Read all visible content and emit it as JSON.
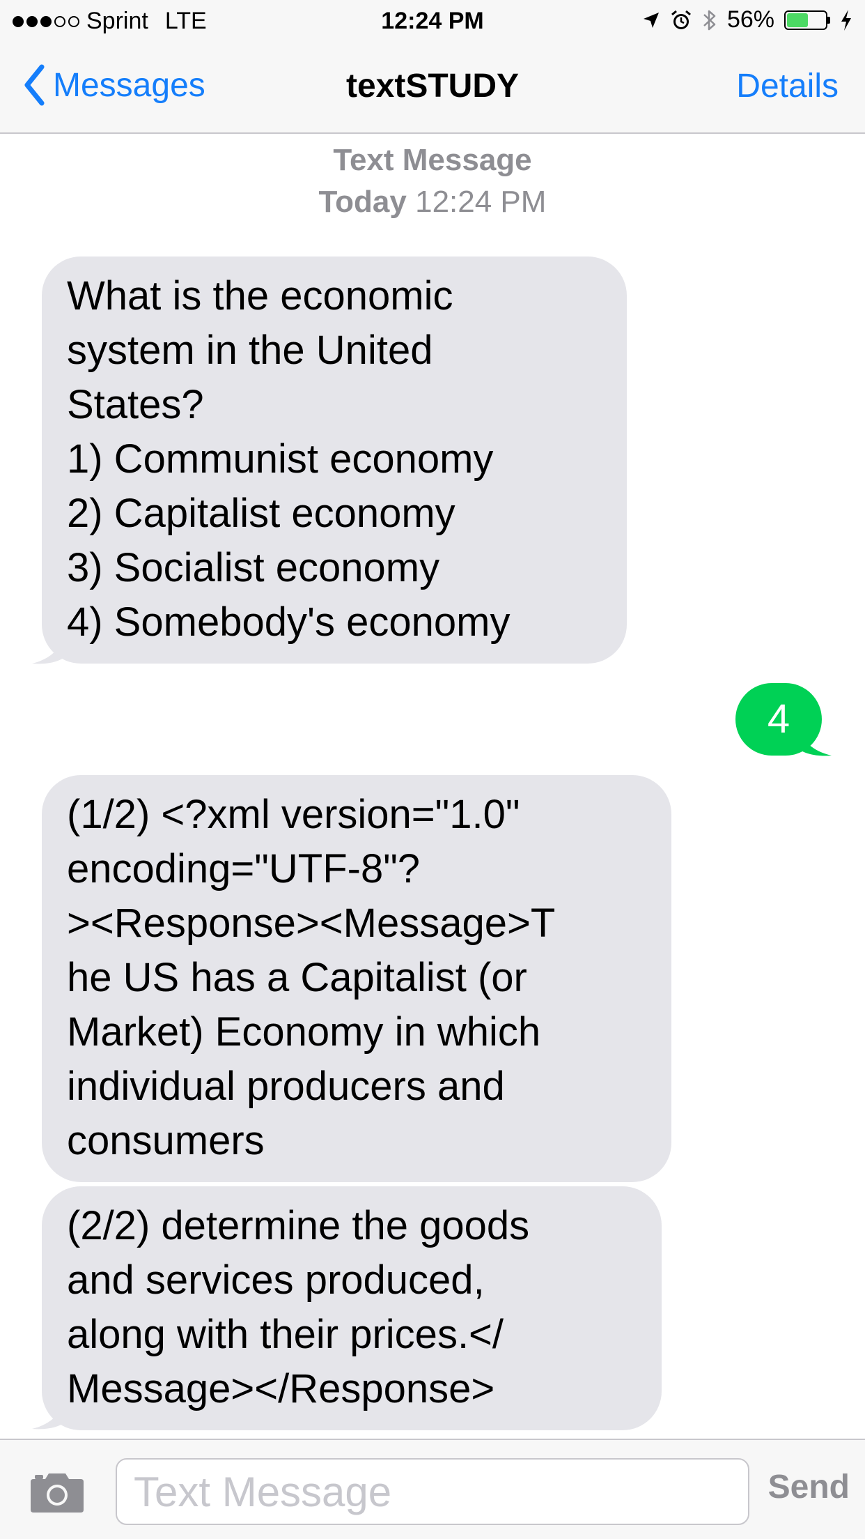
{
  "status_bar": {
    "signal_bars_filled": 3,
    "signal_bars_total": 5,
    "carrier": "Sprint",
    "network": "LTE",
    "time": "12:24 PM",
    "battery_percent": "56%",
    "battery_level": 0.56,
    "battery_fill_color": "#4cd964",
    "icons": [
      "location-arrow-icon",
      "alarm-icon",
      "bluetooth-icon",
      "battery-icon",
      "charging-bolt-icon"
    ]
  },
  "nav": {
    "back_label": "Messages",
    "title": "textSTUDY",
    "details_label": "Details",
    "accent_color": "#157efb"
  },
  "conversation": {
    "header_type": "Text Message",
    "header_day": "Today",
    "header_time": "12:24 PM",
    "messages": [
      {
        "direction": "received",
        "text": "What is the economic\nsystem in the United\nStates?\n1) Communist economy\n2) Capitalist economy\n3) Socialist economy\n4) Somebody's economy"
      },
      {
        "direction": "sent",
        "text": "4"
      },
      {
        "direction": "received",
        "text": "(1/2) <?xml version=\"1.0\"\nencoding=\"UTF-8\"?\n><Response><Message>T\nhe US has a Capitalist (or\nMarket) Economy in which\nindividual producers and\nconsumers"
      },
      {
        "direction": "received",
        "text": "(2/2) determine the goods\nand services produced,\nalong with their prices.</\nMessage></Response>"
      }
    ],
    "received_bubble_color": "#e5e5ea",
    "sent_bubble_color": "#00d155"
  },
  "composer": {
    "placeholder": "Text Message",
    "value": "",
    "send_label": "Send",
    "camera_icon": "camera-icon"
  }
}
